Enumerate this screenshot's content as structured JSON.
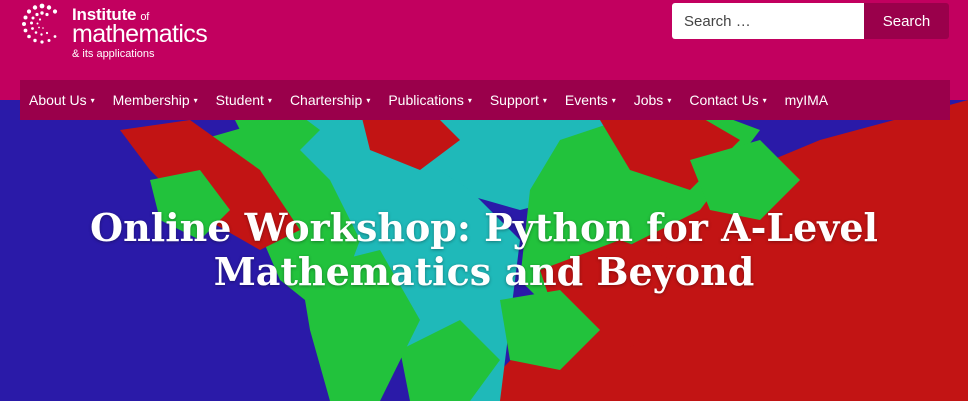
{
  "logo": {
    "line1": "Institute",
    "line1_suffix": "of",
    "line2": "mathematics",
    "line3": "& its applications"
  },
  "search": {
    "placeholder": "Search …",
    "button_label": "Search"
  },
  "nav": {
    "items": [
      {
        "label": "About Us",
        "has_dropdown": true
      },
      {
        "label": "Membership",
        "has_dropdown": true
      },
      {
        "label": "Student",
        "has_dropdown": true
      },
      {
        "label": "Chartership",
        "has_dropdown": true
      },
      {
        "label": "Publications",
        "has_dropdown": true
      },
      {
        "label": "Support",
        "has_dropdown": true
      },
      {
        "label": "Events",
        "has_dropdown": true
      },
      {
        "label": "Jobs",
        "has_dropdown": true
      },
      {
        "label": "Contact Us",
        "has_dropdown": true
      },
      {
        "label": "myIMA",
        "has_dropdown": false
      }
    ],
    "caret": "▾"
  },
  "hero": {
    "title_line1": "Online Workshop: Python for A-Level",
    "title_line2": "Mathematics and Beyond"
  },
  "colors": {
    "brand": "#c2005f",
    "nav_bg": "#9a004b",
    "fractal_blue": "#2a1aa8",
    "fractal_red": "#c21414",
    "fractal_green": "#22c23c",
    "fractal_cyan": "#1fb9b9"
  }
}
